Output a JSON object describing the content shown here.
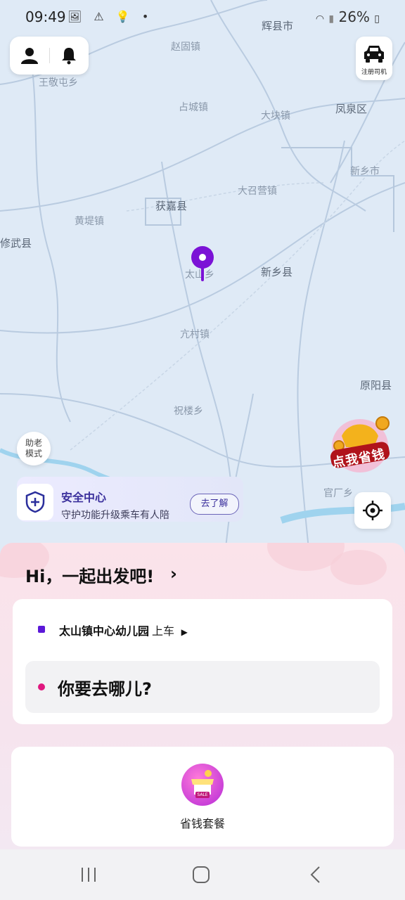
{
  "status": {
    "time": "09:49",
    "left_icons": "🖼 ⚠ 💡 •",
    "battery": "26%"
  },
  "map": {
    "places": [
      {
        "name": "辉县市",
        "big": true
      },
      {
        "name": "赵固镇",
        "big": false
      },
      {
        "name": "王敬屯乡",
        "big": false
      },
      {
        "name": "占城镇",
        "big": false
      },
      {
        "name": "大块镇",
        "big": false
      },
      {
        "name": "凤泉区",
        "big": true
      },
      {
        "name": "新乡市",
        "big": false
      },
      {
        "name": "获嘉县",
        "big": true
      },
      {
        "name": "大召营镇",
        "big": false
      },
      {
        "name": "黄堤镇",
        "big": false
      },
      {
        "name": "修武县",
        "big": true
      },
      {
        "name": "太山乡",
        "big": false
      },
      {
        "name": "新乡县",
        "big": true
      },
      {
        "name": "亢村镇",
        "big": false
      },
      {
        "name": "原阳县",
        "big": true
      },
      {
        "name": "祝楼乡",
        "big": false
      },
      {
        "name": "官厂乡",
        "big": false
      }
    ]
  },
  "driver_button": {
    "label": "注册司机"
  },
  "elder_mode": {
    "label": "助老\n模式"
  },
  "promo": {
    "label": "点我省钱"
  },
  "safety": {
    "title": "安全中心",
    "subtitle": "守护功能升级乘车有人陪",
    "action": "去了解"
  },
  "sheet": {
    "greeting": "Hi，一起出发吧!",
    "from_place": "太山镇中心幼儿园",
    "from_suffix": "上车",
    "to_placeholder": "你要去哪儿?",
    "package_label": "省钱套餐",
    "package_badge": "SALE"
  },
  "colors": {
    "pin": "#7b12d6",
    "from_dot": "#5b18d8",
    "to_dot": "#e0187f"
  }
}
